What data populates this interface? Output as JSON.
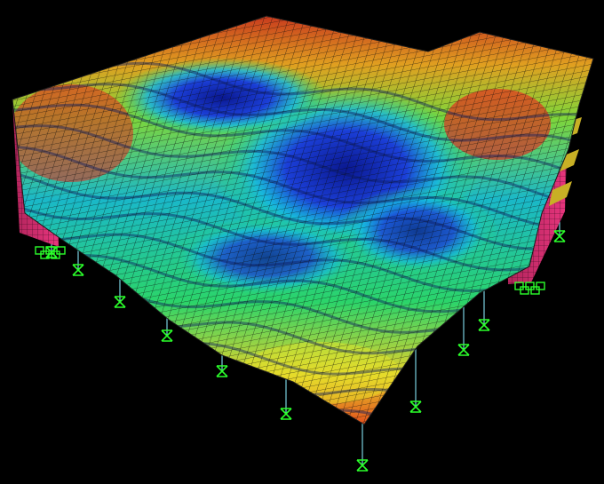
{
  "viewport": {
    "background": "#000000"
  },
  "model": {
    "view": "3d-deformed-shape",
    "contour_palette": [
      "#0b1a9c",
      "#1f46e0",
      "#16c8e8",
      "#2ee05a",
      "#e6e62a",
      "#f08a1e",
      "#e5261e",
      "#e0317a"
    ],
    "wall_color": "#e0317a",
    "grid_color": "#111111",
    "column_color": "#7ad0e0",
    "support_color": "#2bff2b"
  }
}
